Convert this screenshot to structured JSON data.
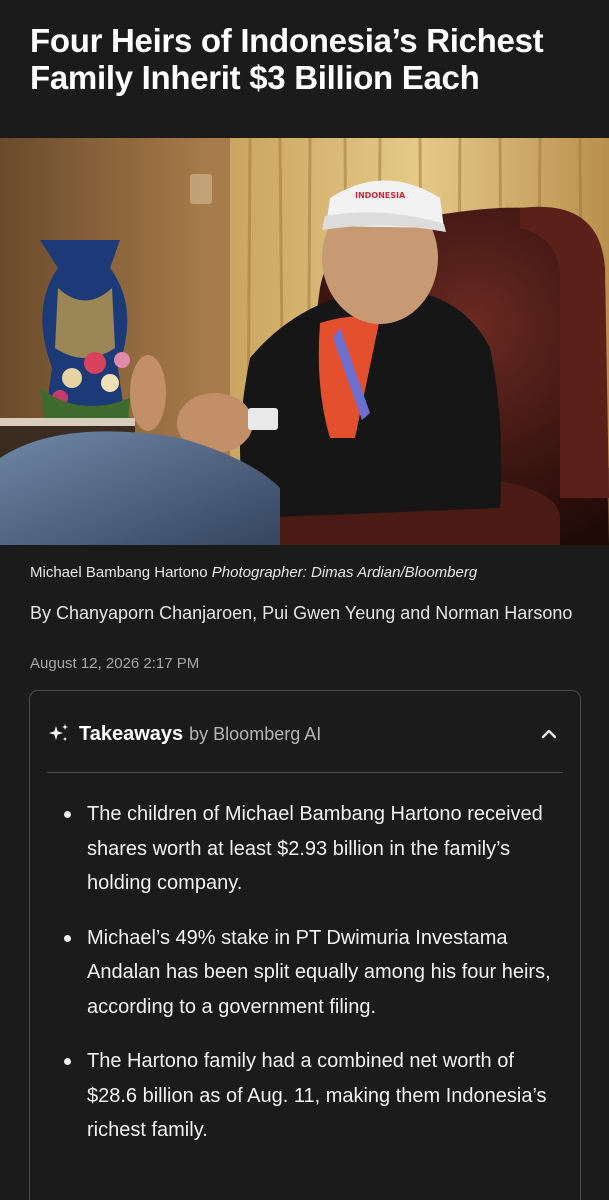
{
  "article": {
    "headline": "Four Heirs of Indonesia’s Richest Family Inherit $3 Billion Each",
    "photo": {
      "caption_subject": "Michael Bambang Hartono",
      "caption_credit": "Photographer: Dimas Ardian/Bloomberg"
    },
    "byline": "By Chanyaporn Chanjaroen, Pui Gwen Yeung and Norman Harsono",
    "date": "August 12, 2026 2:17 PM"
  },
  "takeaways": {
    "icon": "sparkle-icon",
    "title": "Takeaways",
    "by": "by Bloomberg AI",
    "collapse_icon": "chevron-up-icon",
    "items": [
      "The children of Michael Bambang Hartono received shares worth at least $2.93 billion in the family’s holding company.",
      "Michael’s 49% stake in PT Dwimuria Investama Andalan has been split equally among his four heirs, according to a government filing.",
      "The Hartono family had a combined net worth of $28.6 billion as of Aug. 11, making them Indonesia’s richest family."
    ]
  },
  "colors": {
    "background": "#1b1b1b",
    "text": "#ffffff",
    "muted": "#a6a6a6",
    "border": "#4c4c4c"
  }
}
